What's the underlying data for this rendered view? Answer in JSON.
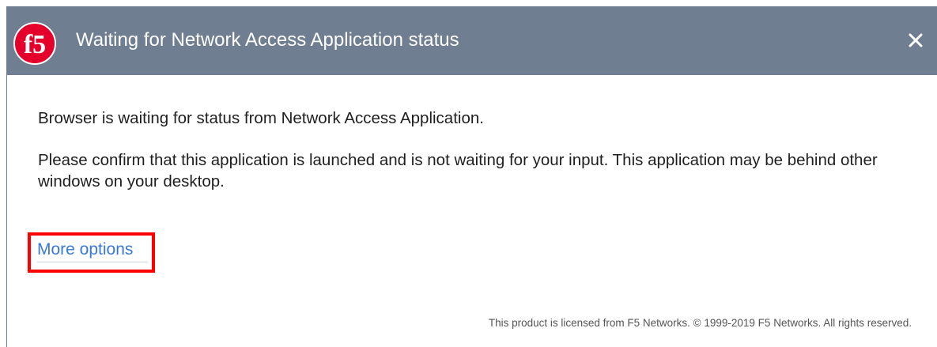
{
  "dialog": {
    "title": "Waiting for Network Access Application status",
    "close_label": "×",
    "logo_text": "f5",
    "message_1": "Browser is waiting for status from Network Access Application.",
    "message_2": "Please confirm that this application is launched and is not waiting for your input. This application may be behind other windows on your desktop.",
    "more_options_link": "More options",
    "footer": "This product is licensed from F5 Networks. © 1999-2019 F5 Networks. All rights reserved."
  },
  "colors": {
    "titlebar": "#6f7e90",
    "logo_red": "#e4002b",
    "link": "#3a78d8",
    "highlight": "#ff0000"
  },
  "icons": {
    "logo": "f5-logo-icon",
    "close": "close-icon"
  }
}
